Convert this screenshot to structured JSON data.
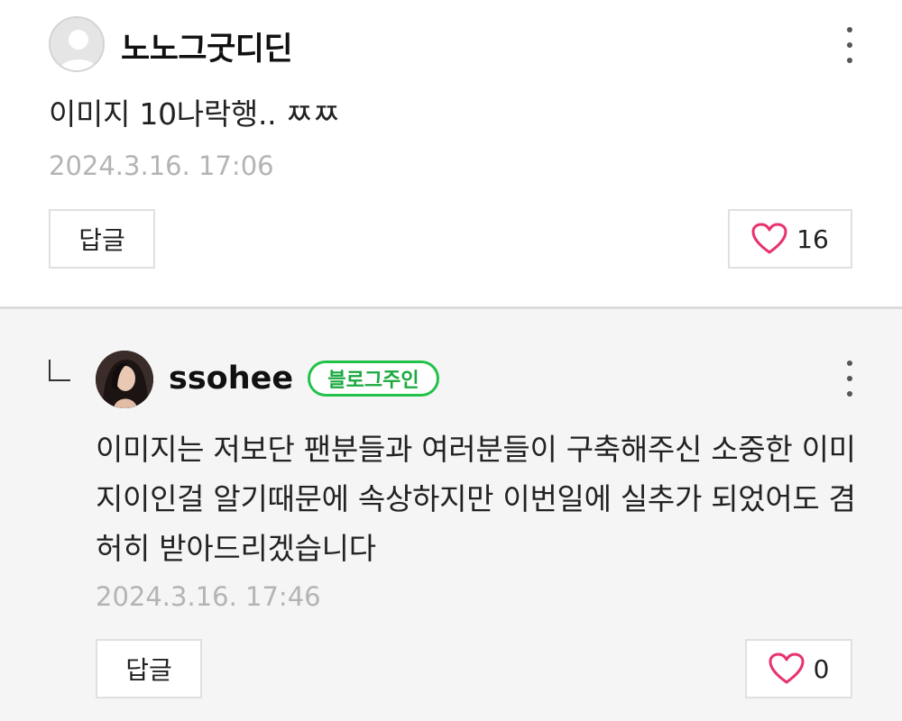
{
  "comments": [
    {
      "author": "노노그굿디딘",
      "text": "이미지 10나락행.. ㅉㅉ",
      "date": "2024.3.16. 17:06",
      "reply_label": "답글",
      "likes": "16",
      "avatar": "default-avatar-icon"
    },
    {
      "author": "ssohee",
      "badge": "블로그주인",
      "text": "이미지는 저보단 팬분들과 여러분들이 구축해주신 소중한 이미지이인걸 알기때문에 속상하지만 이번일에 실추가 되었어도 겸허히 받아드리겠습니다",
      "date": "2024.3.16. 17:46",
      "reply_label": "답글",
      "likes": "0",
      "avatar": "profile-photo"
    }
  ],
  "colors": {
    "heart": "#e8336d",
    "badge": "#22c24a",
    "meta_text": "#b4b4b4",
    "reply_background": "#f5f5f5"
  },
  "icons": [
    "more-options-icon",
    "heart-icon",
    "reply-arrow-icon"
  ]
}
